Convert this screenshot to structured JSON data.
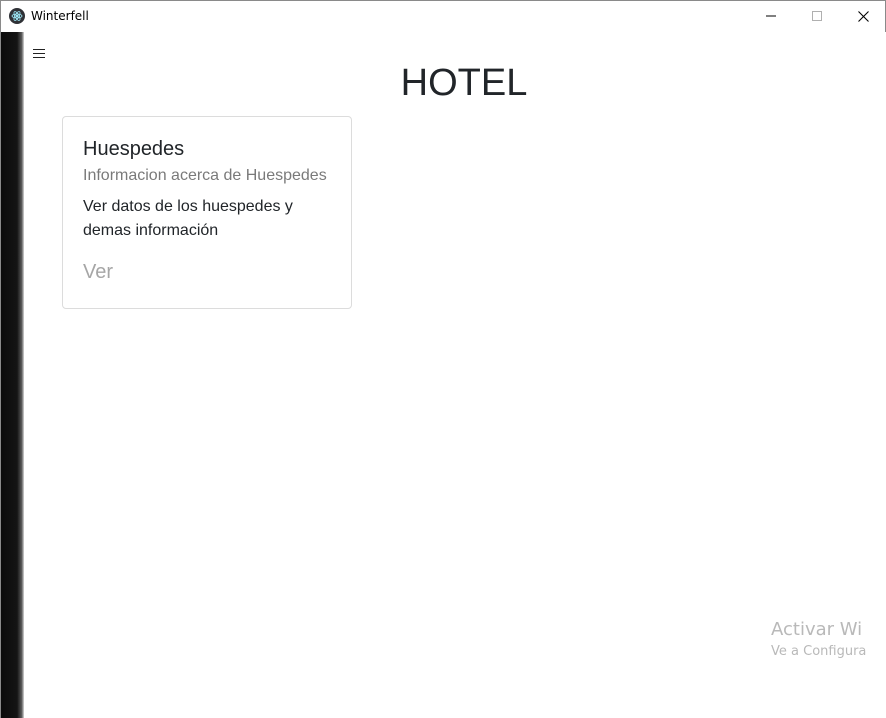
{
  "window": {
    "title": "Winterfell",
    "app_icon": "electron-icon",
    "controls": [
      "minimize-icon",
      "maximize-icon",
      "close-icon"
    ]
  },
  "nav": {
    "menu_icon": "hamburger-icon"
  },
  "page": {
    "title": "HOTEL"
  },
  "card": {
    "title": "Huespedes",
    "subtitle": "Informacion acerca de Huespedes",
    "text": "Ver datos de los huespedes y demas información",
    "link_label": "Ver"
  },
  "watermark": {
    "line1": "Activar Wi",
    "line2": "Ve a Configura"
  },
  "colors": {
    "title_text": "#212529",
    "subtitle_text": "#7a7a7a",
    "link_text": "#a6a6a6",
    "card_border": "#dcdcdc"
  }
}
